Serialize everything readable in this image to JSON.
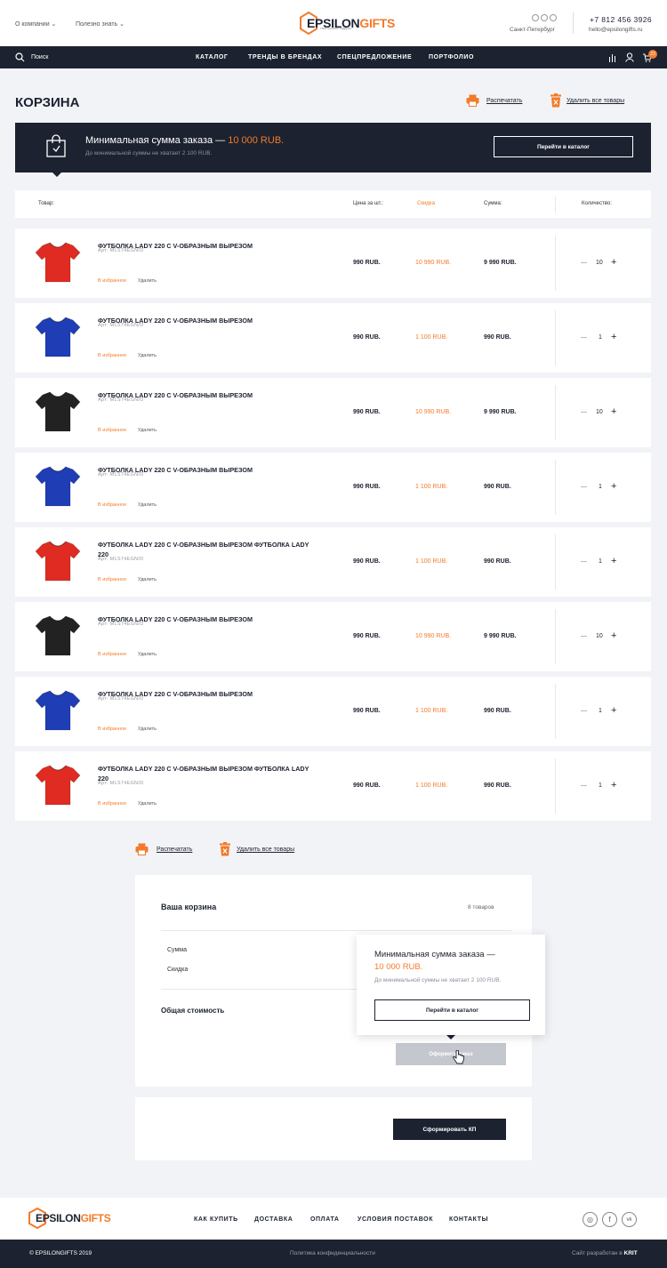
{
  "header": {
    "nav_left": [
      "О компании ⌄",
      "Полезно знать ⌄"
    ],
    "logo_main": "EPSILON",
    "logo_accent": "GIFTS",
    "logo_tag": "твой лучший подарок",
    "city": "Санкт-Петербург",
    "phone": "+7 812 456 3926",
    "email": "hello@epsilongifts.ru",
    "cart_count": "23"
  },
  "navbar": {
    "search": "Поиск",
    "items": [
      "КАТАЛОГ",
      "ТРЕНДЫ В БРЕНДАХ",
      "СПЕЦПРЕДЛОЖЕНИЕ",
      "ПОРТФОЛИО"
    ]
  },
  "page": {
    "title": "КОРЗИНА",
    "print": "Распечатать",
    "delete_all": "Удалить все товары"
  },
  "banner": {
    "title_prefix": "Минимальная сумма заказа — ",
    "title_amount": "10 000 RUB.",
    "subtitle": "До минимальной суммы не хватает 2 100 RUB.",
    "button": "Перейти в каталог"
  },
  "table_header": {
    "product": "Товар:",
    "price": "Цена за шт.:",
    "discount": "Скидка",
    "sum": "Сумма:",
    "quantity": "Количество:"
  },
  "row_labels": {
    "fav": "В избранное",
    "del": "Удалить"
  },
  "items": [
    {
      "title": "ФУТБОЛКА LADY 220 С V-ОБРАЗНЫМ ВЫРЕЗОМ",
      "art": "Арт: MLS74EGN/D",
      "price": "990 RUB.",
      "discount": "10 990 RUB.",
      "sum": "9 990 RUB.",
      "qty": "10",
      "color": "#e02b22"
    },
    {
      "title": "ФУТБОЛКА LADY 220 С V-ОБРАЗНЫМ ВЫРЕЗОМ",
      "art": "Арт: MLS74EGN/D",
      "price": "990 RUB.",
      "discount": "1 100 RUB.",
      "sum": "990 RUB.",
      "qty": "1",
      "color": "#1f3db5"
    },
    {
      "title": "ФУТБОЛКА LADY 220 С V-ОБРАЗНЫМ ВЫРЕЗОМ",
      "art": "Арт: MLS74EGN/D",
      "price": "990 RUB.",
      "discount": "10 990 RUB.",
      "sum": "9 990 RUB.",
      "qty": "10",
      "color": "#222222"
    },
    {
      "title": "ФУТБОЛКА LADY 220 С V-ОБРАЗНЫМ ВЫРЕЗОМ",
      "art": "Арт: MLS74EGN/D",
      "price": "990 RUB.",
      "discount": "1 100 RUB.",
      "sum": "990 RUB.",
      "qty": "1",
      "color": "#1f3db5"
    },
    {
      "title": "ФУТБОЛКА LADY 220 С V-ОБРАЗНЫМ ВЫРЕЗОМ ФУТБОЛКА LADY 220",
      "art": "Арт: MLS74EGN/D",
      "price": "990 RUB.",
      "discount": "1 100 RUB.",
      "sum": "990 RUB.",
      "qty": "1",
      "color": "#e02b22"
    },
    {
      "title": "ФУТБОЛКА LADY 220 С V-ОБРАЗНЫМ ВЫРЕЗОМ",
      "art": "Арт: MLS74EGN/D",
      "price": "990 RUB.",
      "discount": "10 990 RUB.",
      "sum": "9 990 RUB.",
      "qty": "10",
      "color": "#222222"
    },
    {
      "title": "ФУТБОЛКА LADY 220 С V-ОБРАЗНЫМ ВЫРЕЗОМ",
      "art": "Арт: MLS74EGN/D",
      "price": "990 RUB.",
      "discount": "1 100 RUB.",
      "sum": "990 RUB.",
      "qty": "1",
      "color": "#1f3db5"
    },
    {
      "title": "ФУТБОЛКА LADY 220 С V-ОБРАЗНЫМ ВЫРЕЗОМ ФУТБОЛКА LADY 220",
      "art": "Арт: MLS74EGN/D",
      "price": "990 RUB.",
      "discount": "1 100 RUB.",
      "sum": "990 RUB.",
      "qty": "1",
      "color": "#e02b22"
    }
  ],
  "summary": {
    "title": "Ваша корзина",
    "count": "8 товаров",
    "sum_label": "Сумма",
    "discount_label": "Скидка",
    "total_label": "Общая стоимость",
    "checkout": "Оформить заказ",
    "popup_title": "Минимальная сумма заказа —",
    "popup_amount": "10 000 RUB.",
    "popup_sub": "До минимальной суммы не хватает 2 100 RUB.",
    "popup_button": "Перейти в каталог",
    "kp_button": "Сформировать КП"
  },
  "footer": {
    "nav": [
      "КАК КУПИТЬ",
      "ДОСТАВКА",
      "ОПЛАТА",
      "УСЛОВИЯ ПОСТАВОК",
      "КОНТАКТЫ"
    ],
    "copyright": "© EPSILONGIFTS 2019",
    "privacy": "Политика конфиденциальности",
    "dev_prefix": "Сайт разработан в ",
    "dev_name": "KRIT"
  },
  "colors": {
    "accent": "#f37a2a",
    "dark": "#1c2230",
    "bg": "#f2f3f6"
  }
}
